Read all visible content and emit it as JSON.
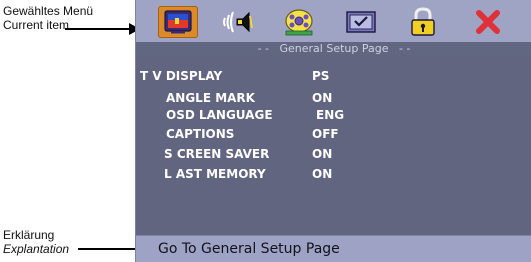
{
  "annotations": {
    "current_item_de": "Gewähltes Menü",
    "current_item_en": "Current item",
    "explanation_de": "Erklärung",
    "explanation_en": "Explantation"
  },
  "tabs": [
    {
      "icon": "general-setup-icon",
      "active": true
    },
    {
      "icon": "audio-speaker-icon",
      "active": false
    },
    {
      "icon": "video-reel-icon",
      "active": false
    },
    {
      "icon": "preferences-checkbox-icon",
      "active": false
    },
    {
      "icon": "password-lock-icon",
      "active": false
    },
    {
      "icon": "exit-x-icon",
      "active": false
    }
  ],
  "page_header": "- -   General Setup Page   - -",
  "settings": [
    {
      "label": "T V DISPLAY",
      "value": "PS"
    },
    {
      "label": "ANGLE MARK",
      "value": "ON"
    },
    {
      "label": "OSD LANGUAGE",
      "value": "ENG"
    },
    {
      "label": "CAPTIONS",
      "value": "OFF"
    },
    {
      "label": "S CREEN SAVER",
      "value": "ON"
    },
    {
      "label": "L AST MEMORY",
      "value": "ON"
    }
  ],
  "status_text": "Go To General Setup Page",
  "colors": {
    "screen_bg": "#9fa4c4",
    "content_bg": "#626580",
    "active_tab": "#d98a2b",
    "exit_red": "#e0303a"
  }
}
